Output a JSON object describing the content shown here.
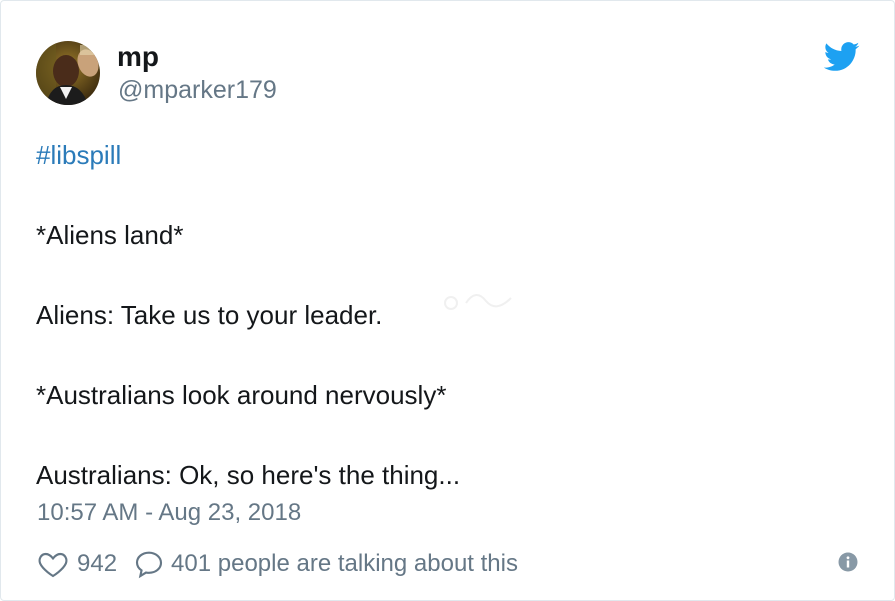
{
  "tweet": {
    "author": {
      "name": "mp",
      "handle": "@mparker179",
      "avatar_icon": "avatar-photo"
    },
    "platform_icon": "twitter-bird-icon",
    "brand_color": "#1da1f2",
    "link_color": "#2b7bb9",
    "lines": [
      "#libspill",
      "",
      "*Aliens land*",
      "",
      "Aliens: Take us to your leader.",
      "",
      "*Australians look around nervously*",
      "",
      "Australians: Ok, so here's the thing..."
    ],
    "timestamp": "10:57 AM - Aug 23, 2018",
    "likes": "942",
    "talking": "401 people are talking about this",
    "like_icon": "heart-icon",
    "reply_icon": "speech-bubble-icon",
    "info_icon": "info-icon"
  }
}
